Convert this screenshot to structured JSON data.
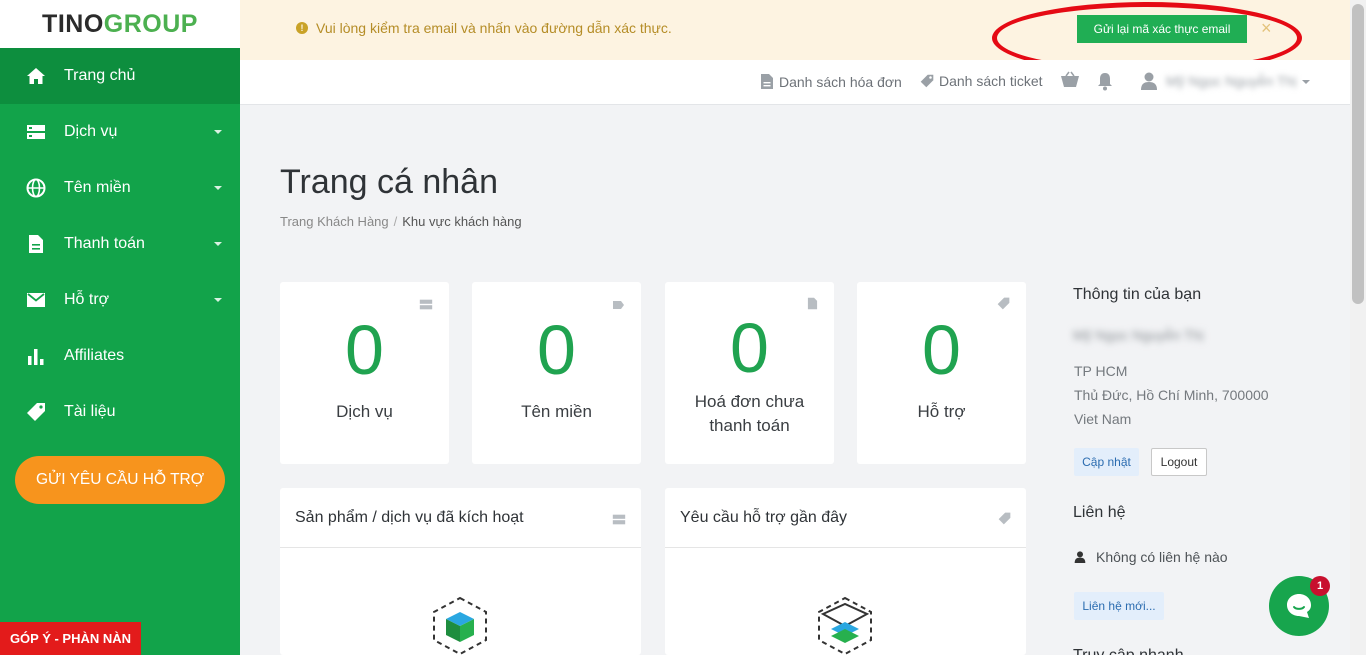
{
  "logo": {
    "part1": "TINO",
    "part2": "GROUP"
  },
  "sidebar": {
    "items": [
      {
        "label": "Trang chủ",
        "icon": "home-icon"
      },
      {
        "label": "Dịch vụ",
        "icon": "server-icon"
      },
      {
        "label": "Tên miền",
        "icon": "globe-icon"
      },
      {
        "label": "Thanh toán",
        "icon": "document-icon"
      },
      {
        "label": "Hỗ trợ",
        "icon": "mail-icon"
      },
      {
        "label": "Affiliates",
        "icon": "bar-chart-icon"
      },
      {
        "label": "Tài liệu",
        "icon": "tag-icon"
      }
    ],
    "support_button": "GỬI YÊU CẦU HỖ TRỢ",
    "feedback_button": "GÓP Ý - PHÀN NÀN"
  },
  "alert": {
    "text": "Vui lòng kiểm tra email và nhấn vào đường dẫn xác thực.",
    "button": "Gửi lại mã xác thực email",
    "close": "×"
  },
  "topnav": {
    "invoices": "Danh sách hóa đơn",
    "tickets": "Danh sách ticket",
    "user_name": "Mỹ Ngọc Nguyễn Thị"
  },
  "page": {
    "title": "Trang cá nhân",
    "breadcrumb": [
      "Trang Khách Hàng",
      "Khu vực khách hàng"
    ]
  },
  "stats": [
    {
      "value": "0",
      "label": "Dịch vụ",
      "icon": "server-icon"
    },
    {
      "value": "0",
      "label": "Tên miền",
      "icon": "tag-icon"
    },
    {
      "value": "0",
      "label_line1": "Hoá đơn chưa",
      "label_line2": "thanh toán",
      "icon": "document-icon"
    },
    {
      "value": "0",
      "label": "Hỗ trợ",
      "icon": "tag-icon"
    }
  ],
  "panels": [
    {
      "title": "Sản phẩm / dịch vụ đã kích hoạt",
      "icon": "server-icon"
    },
    {
      "title": "Yêu cầu hỗ trợ gần đây",
      "icon": "tag-icon"
    }
  ],
  "profile": {
    "heading": "Thông tin của bạn",
    "name": "Mỹ Ngọc Nguyễn Thị",
    "city": "TP HCM",
    "address": "Thủ Đức, Hồ Chí Minh, 700000",
    "country": "Viet Nam",
    "update_button": "Cập nhật",
    "logout_button": "Logout"
  },
  "contacts": {
    "heading": "Liên hệ",
    "empty": "Không có liên hệ nào",
    "new_button": "Liên hệ mới..."
  },
  "quick_access": {
    "heading": "Truy cập nhanh"
  },
  "chat": {
    "badge": "1"
  },
  "colors": {
    "sidebar": "#12a34a",
    "accent": "#20a350",
    "support_button": "#f7941d",
    "feedback": "#e31b1b",
    "highlight": "#e50a14"
  }
}
